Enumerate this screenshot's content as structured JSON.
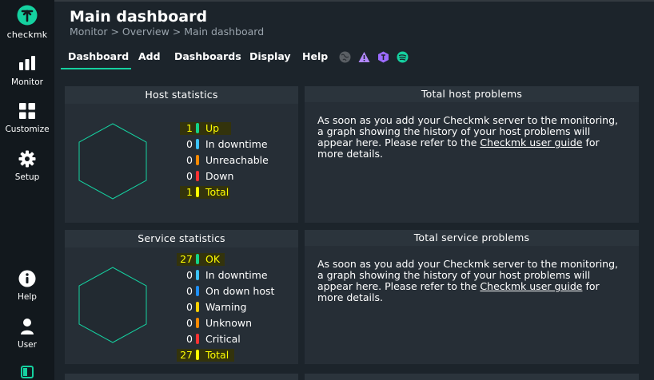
{
  "sidebar": {
    "logo_text": "checkmk",
    "items": [
      {
        "label": "Monitor",
        "icon": "bar-chart-icon"
      },
      {
        "label": "Customize",
        "icon": "grid-icon"
      },
      {
        "label": "Setup",
        "icon": "gear-icon"
      },
      {
        "label": "Help",
        "icon": "info-icon"
      },
      {
        "label": "User",
        "icon": "user-icon"
      }
    ]
  },
  "header": {
    "title": "Main dashboard",
    "breadcrumb": "Monitor > Overview > Main dashboard"
  },
  "menu": {
    "items": [
      "Dashboard",
      "Add",
      "Dashboards",
      "Display",
      "Help"
    ],
    "icons": [
      "globe-icon",
      "warning-icon",
      "hex-icon",
      "spotify-icon"
    ]
  },
  "host_stats": {
    "title": "Host statistics",
    "rows": [
      {
        "count": "1",
        "label": "Up",
        "color": "#13d389",
        "highlight": true
      },
      {
        "count": "0",
        "label": "In downtime",
        "color": "#3cc2ff",
        "highlight": false
      },
      {
        "count": "0",
        "label": "Unreachable",
        "color": "#ff8a00",
        "highlight": false
      },
      {
        "count": "0",
        "label": "Down",
        "color": "#ff3232",
        "highlight": false
      },
      {
        "count": "1",
        "label": "Total",
        "color": "#ffff00",
        "highlight": true
      }
    ]
  },
  "total_host_problems": {
    "title": "Total host problems",
    "text_before": "As soon as you add your Checkmk server to the monitoring, a graph showing the history of your host problems will appear here. Please refer to the ",
    "link": "Checkmk user guide",
    "text_after": " for more details."
  },
  "service_stats": {
    "title": "Service statistics",
    "rows": [
      {
        "count": "27",
        "label": "OK",
        "color": "#13d389",
        "highlight": true
      },
      {
        "count": "0",
        "label": "In downtime",
        "color": "#3cc2ff",
        "highlight": false
      },
      {
        "count": "0",
        "label": "On down host",
        "color": "#1e90ff",
        "highlight": false
      },
      {
        "count": "0",
        "label": "Warning",
        "color": "#ffd000",
        "highlight": false
      },
      {
        "count": "0",
        "label": "Unknown",
        "color": "#ff8a00",
        "highlight": false
      },
      {
        "count": "0",
        "label": "Critical",
        "color": "#ff3232",
        "highlight": false
      },
      {
        "count": "27",
        "label": "Total",
        "color": "#ffff00",
        "highlight": true
      }
    ]
  },
  "total_service_problems": {
    "title": "Total service problems",
    "text_before": "As soon as you add your Checkmk server to the monitoring, a graph showing the history of your host problems will appear here. Please refer to the ",
    "link": "Checkmk user guide",
    "text_after": " for more details."
  }
}
